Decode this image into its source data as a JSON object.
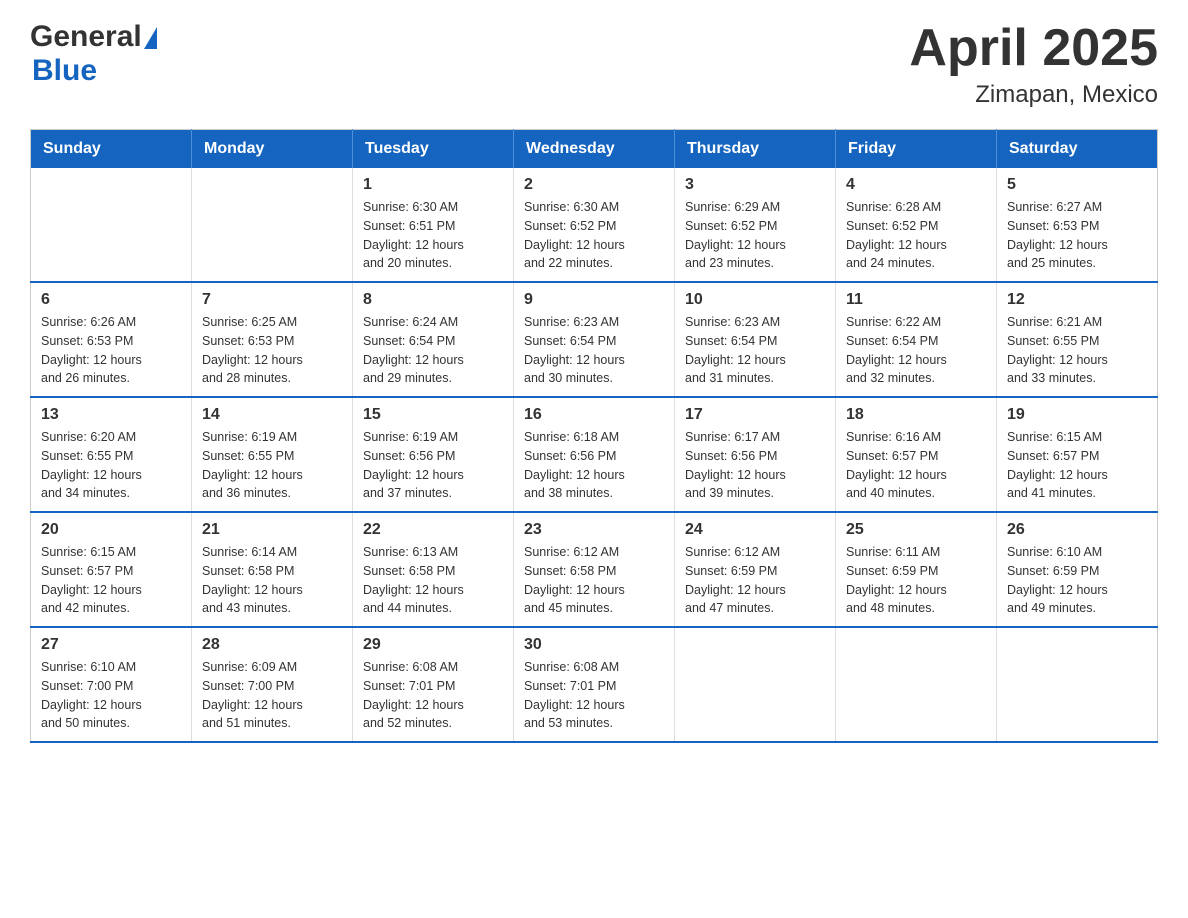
{
  "header": {
    "title": "April 2025",
    "subtitle": "Zimapan, Mexico",
    "logo_general": "General",
    "logo_blue": "Blue"
  },
  "weekdays": [
    "Sunday",
    "Monday",
    "Tuesday",
    "Wednesday",
    "Thursday",
    "Friday",
    "Saturday"
  ],
  "weeks": [
    [
      {
        "day": "",
        "info": ""
      },
      {
        "day": "",
        "info": ""
      },
      {
        "day": "1",
        "info": "Sunrise: 6:30 AM\nSunset: 6:51 PM\nDaylight: 12 hours\nand 20 minutes."
      },
      {
        "day": "2",
        "info": "Sunrise: 6:30 AM\nSunset: 6:52 PM\nDaylight: 12 hours\nand 22 minutes."
      },
      {
        "day": "3",
        "info": "Sunrise: 6:29 AM\nSunset: 6:52 PM\nDaylight: 12 hours\nand 23 minutes."
      },
      {
        "day": "4",
        "info": "Sunrise: 6:28 AM\nSunset: 6:52 PM\nDaylight: 12 hours\nand 24 minutes."
      },
      {
        "day": "5",
        "info": "Sunrise: 6:27 AM\nSunset: 6:53 PM\nDaylight: 12 hours\nand 25 minutes."
      }
    ],
    [
      {
        "day": "6",
        "info": "Sunrise: 6:26 AM\nSunset: 6:53 PM\nDaylight: 12 hours\nand 26 minutes."
      },
      {
        "day": "7",
        "info": "Sunrise: 6:25 AM\nSunset: 6:53 PM\nDaylight: 12 hours\nand 28 minutes."
      },
      {
        "day": "8",
        "info": "Sunrise: 6:24 AM\nSunset: 6:54 PM\nDaylight: 12 hours\nand 29 minutes."
      },
      {
        "day": "9",
        "info": "Sunrise: 6:23 AM\nSunset: 6:54 PM\nDaylight: 12 hours\nand 30 minutes."
      },
      {
        "day": "10",
        "info": "Sunrise: 6:23 AM\nSunset: 6:54 PM\nDaylight: 12 hours\nand 31 minutes."
      },
      {
        "day": "11",
        "info": "Sunrise: 6:22 AM\nSunset: 6:54 PM\nDaylight: 12 hours\nand 32 minutes."
      },
      {
        "day": "12",
        "info": "Sunrise: 6:21 AM\nSunset: 6:55 PM\nDaylight: 12 hours\nand 33 minutes."
      }
    ],
    [
      {
        "day": "13",
        "info": "Sunrise: 6:20 AM\nSunset: 6:55 PM\nDaylight: 12 hours\nand 34 minutes."
      },
      {
        "day": "14",
        "info": "Sunrise: 6:19 AM\nSunset: 6:55 PM\nDaylight: 12 hours\nand 36 minutes."
      },
      {
        "day": "15",
        "info": "Sunrise: 6:19 AM\nSunset: 6:56 PM\nDaylight: 12 hours\nand 37 minutes."
      },
      {
        "day": "16",
        "info": "Sunrise: 6:18 AM\nSunset: 6:56 PM\nDaylight: 12 hours\nand 38 minutes."
      },
      {
        "day": "17",
        "info": "Sunrise: 6:17 AM\nSunset: 6:56 PM\nDaylight: 12 hours\nand 39 minutes."
      },
      {
        "day": "18",
        "info": "Sunrise: 6:16 AM\nSunset: 6:57 PM\nDaylight: 12 hours\nand 40 minutes."
      },
      {
        "day": "19",
        "info": "Sunrise: 6:15 AM\nSunset: 6:57 PM\nDaylight: 12 hours\nand 41 minutes."
      }
    ],
    [
      {
        "day": "20",
        "info": "Sunrise: 6:15 AM\nSunset: 6:57 PM\nDaylight: 12 hours\nand 42 minutes."
      },
      {
        "day": "21",
        "info": "Sunrise: 6:14 AM\nSunset: 6:58 PM\nDaylight: 12 hours\nand 43 minutes."
      },
      {
        "day": "22",
        "info": "Sunrise: 6:13 AM\nSunset: 6:58 PM\nDaylight: 12 hours\nand 44 minutes."
      },
      {
        "day": "23",
        "info": "Sunrise: 6:12 AM\nSunset: 6:58 PM\nDaylight: 12 hours\nand 45 minutes."
      },
      {
        "day": "24",
        "info": "Sunrise: 6:12 AM\nSunset: 6:59 PM\nDaylight: 12 hours\nand 47 minutes."
      },
      {
        "day": "25",
        "info": "Sunrise: 6:11 AM\nSunset: 6:59 PM\nDaylight: 12 hours\nand 48 minutes."
      },
      {
        "day": "26",
        "info": "Sunrise: 6:10 AM\nSunset: 6:59 PM\nDaylight: 12 hours\nand 49 minutes."
      }
    ],
    [
      {
        "day": "27",
        "info": "Sunrise: 6:10 AM\nSunset: 7:00 PM\nDaylight: 12 hours\nand 50 minutes."
      },
      {
        "day": "28",
        "info": "Sunrise: 6:09 AM\nSunset: 7:00 PM\nDaylight: 12 hours\nand 51 minutes."
      },
      {
        "day": "29",
        "info": "Sunrise: 6:08 AM\nSunset: 7:01 PM\nDaylight: 12 hours\nand 52 minutes."
      },
      {
        "day": "30",
        "info": "Sunrise: 6:08 AM\nSunset: 7:01 PM\nDaylight: 12 hours\nand 53 minutes."
      },
      {
        "day": "",
        "info": ""
      },
      {
        "day": "",
        "info": ""
      },
      {
        "day": "",
        "info": ""
      }
    ]
  ]
}
